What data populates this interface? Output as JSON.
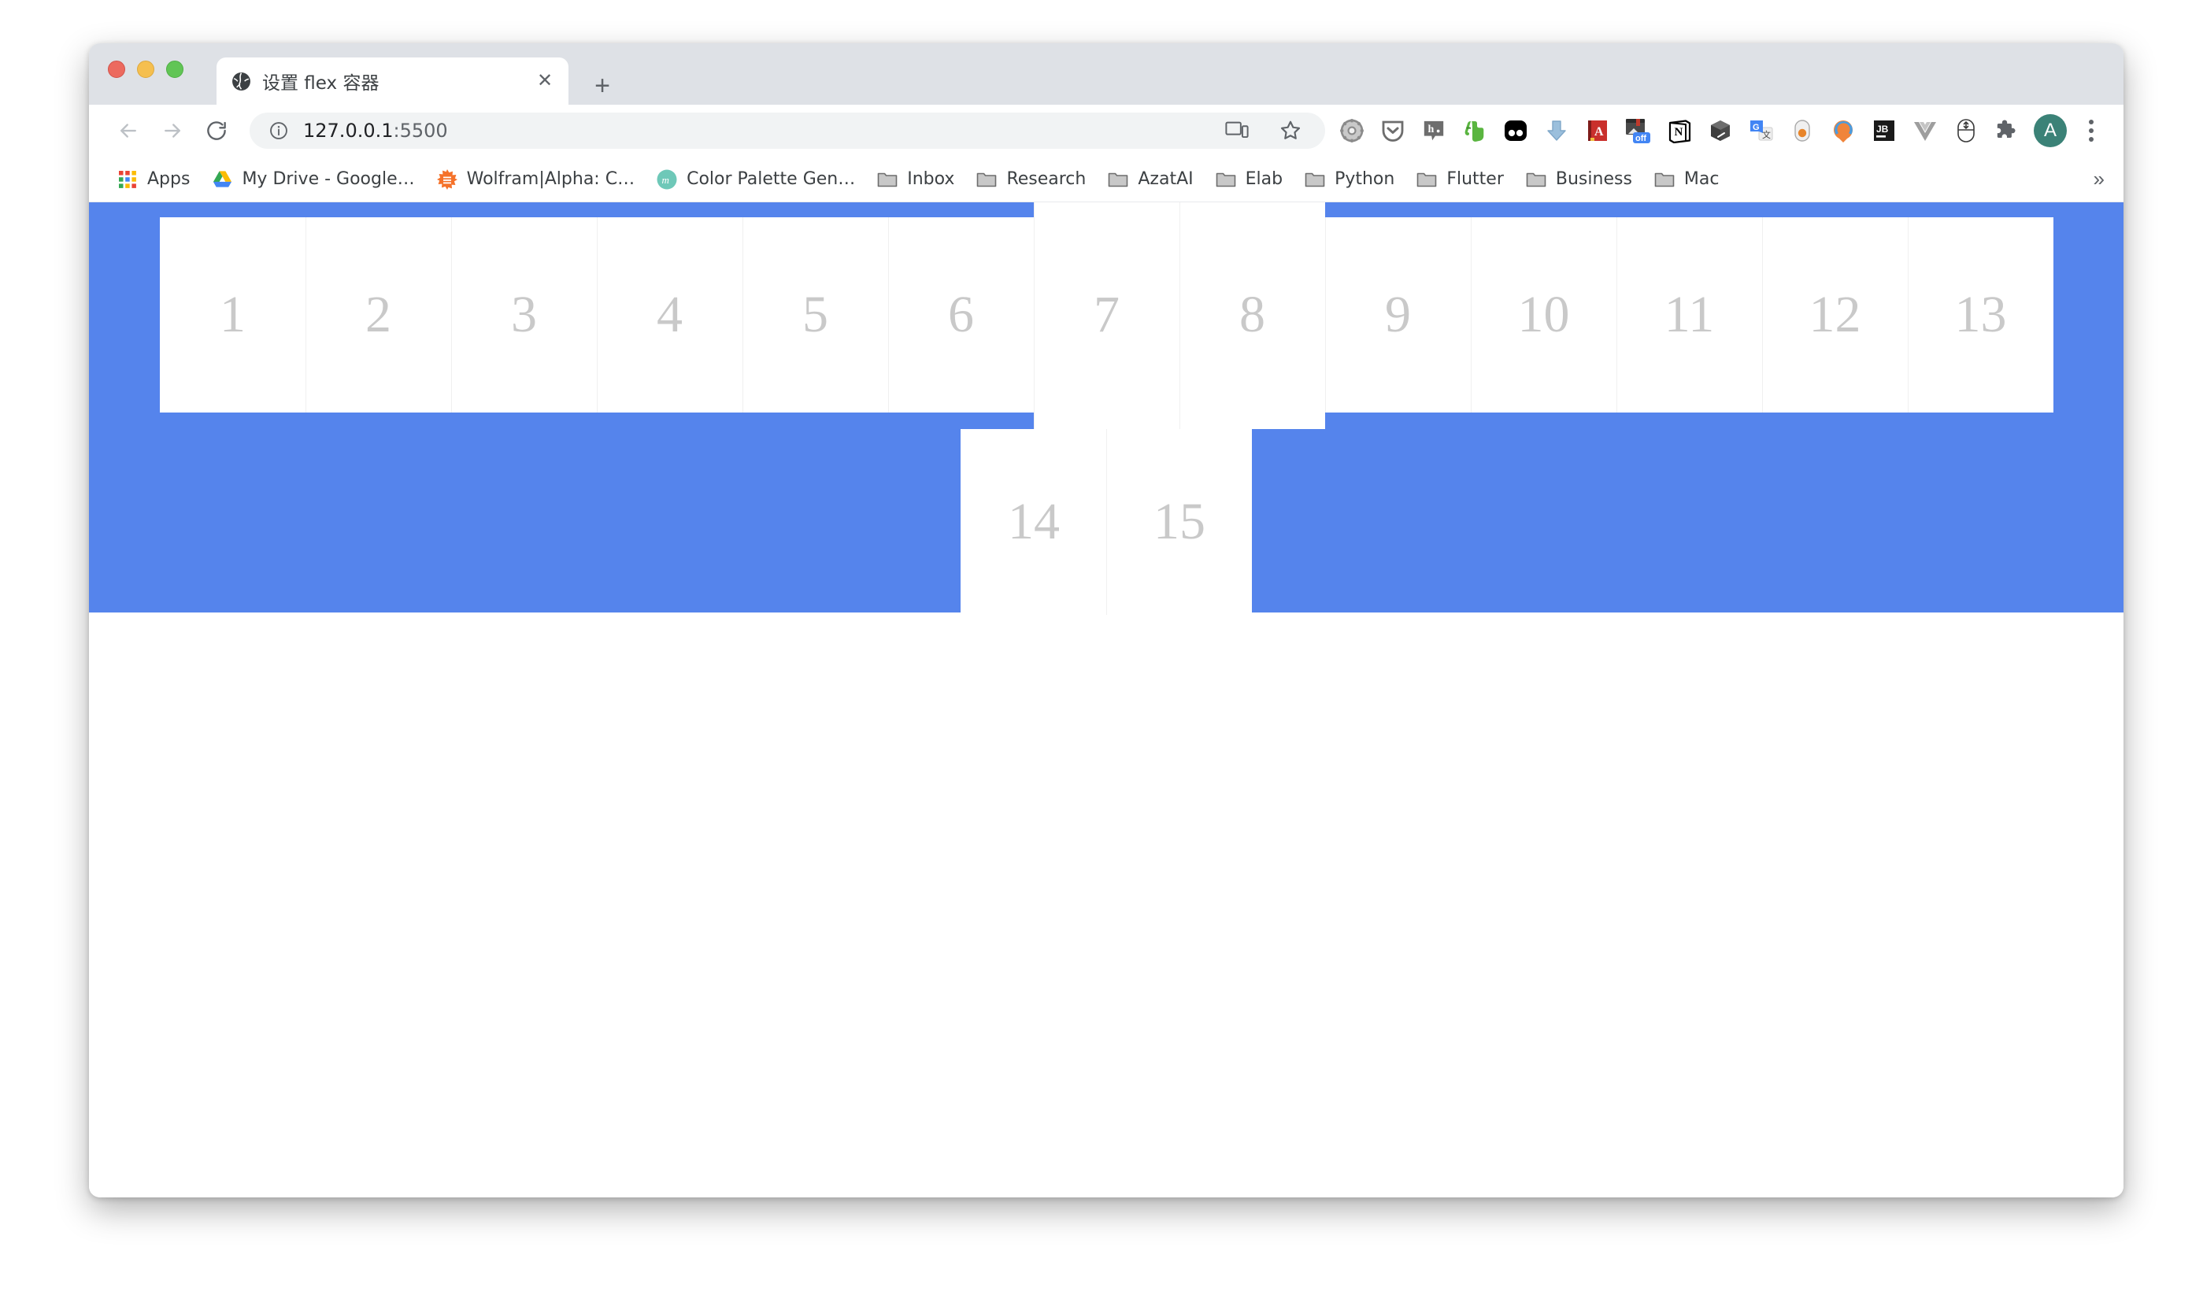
{
  "window": {
    "traffic_lights": [
      "close",
      "minimize",
      "zoom"
    ]
  },
  "tab": {
    "title": "设置 flex 容器",
    "favicon": "globe-icon",
    "close_label": "✕",
    "new_tab_label": "+"
  },
  "toolbar": {
    "back_label": "←",
    "forward_label": "→",
    "reload_label": "⟳",
    "site_info": "info-icon",
    "url": "127.0.0.1",
    "url_port": ":5500",
    "cast_label": "cast-icon",
    "bookmark_star_label": "★",
    "profile_initial": "A",
    "extensions": [
      "gear-extension-icon",
      "pocket-icon",
      "hypothesis-icon",
      "evernote-icon",
      "dark-reader-icon",
      "download-arrow-icon",
      "red-book-icon",
      "bookmark-manager-off-icon",
      "notion-icon",
      "cube-icon",
      "google-translate-icon",
      "capsule-icon",
      "loom-icon",
      "jetbrains-icon",
      "vue-devtools-icon",
      "mouse-icon",
      "puzzle-extensions-icon"
    ],
    "badge_off": "off"
  },
  "bookmarks": {
    "overflow_label": "»",
    "items": [
      {
        "label": "Apps",
        "icon": "apps-grid-icon"
      },
      {
        "label": "My Drive - Google…",
        "icon": "google-drive-icon"
      },
      {
        "label": "Wolfram|Alpha: C…",
        "icon": "wolfram-alpha-icon"
      },
      {
        "label": "Color Palette Gen…",
        "icon": "color-palette-icon"
      },
      {
        "label": "Inbox",
        "icon": "folder-icon"
      },
      {
        "label": "Research",
        "icon": "folder-icon"
      },
      {
        "label": "AzatAI",
        "icon": "folder-icon"
      },
      {
        "label": "Elab",
        "icon": "folder-icon"
      },
      {
        "label": "Python",
        "icon": "folder-icon"
      },
      {
        "label": "Flutter",
        "icon": "folder-icon"
      },
      {
        "label": "Business",
        "icon": "folder-icon"
      },
      {
        "label": "Mac",
        "icon": "folder-icon"
      }
    ]
  },
  "page": {
    "container_background": "#5584ec",
    "item_background": "#ffffff",
    "item_text_color": "#c9c9c9",
    "items": [
      {
        "n": "1",
        "row": 1,
        "height": "normal"
      },
      {
        "n": "2",
        "row": 1,
        "height": "normal"
      },
      {
        "n": "3",
        "row": 1,
        "height": "normal"
      },
      {
        "n": "4",
        "row": 1,
        "height": "normal"
      },
      {
        "n": "5",
        "row": 1,
        "height": "normal"
      },
      {
        "n": "6",
        "row": 1,
        "height": "normal"
      },
      {
        "n": "7",
        "row": 1,
        "height": "tall"
      },
      {
        "n": "8",
        "row": 1,
        "height": "tall"
      },
      {
        "n": "9",
        "row": 1,
        "height": "normal"
      },
      {
        "n": "10",
        "row": 1,
        "height": "normal"
      },
      {
        "n": "11",
        "row": 1,
        "height": "normal"
      },
      {
        "n": "12",
        "row": 1,
        "height": "normal"
      },
      {
        "n": "13",
        "row": 1,
        "height": "normal"
      },
      {
        "n": "14",
        "row": 2,
        "height": "row2"
      },
      {
        "n": "15",
        "row": 2,
        "height": "row2"
      }
    ]
  }
}
